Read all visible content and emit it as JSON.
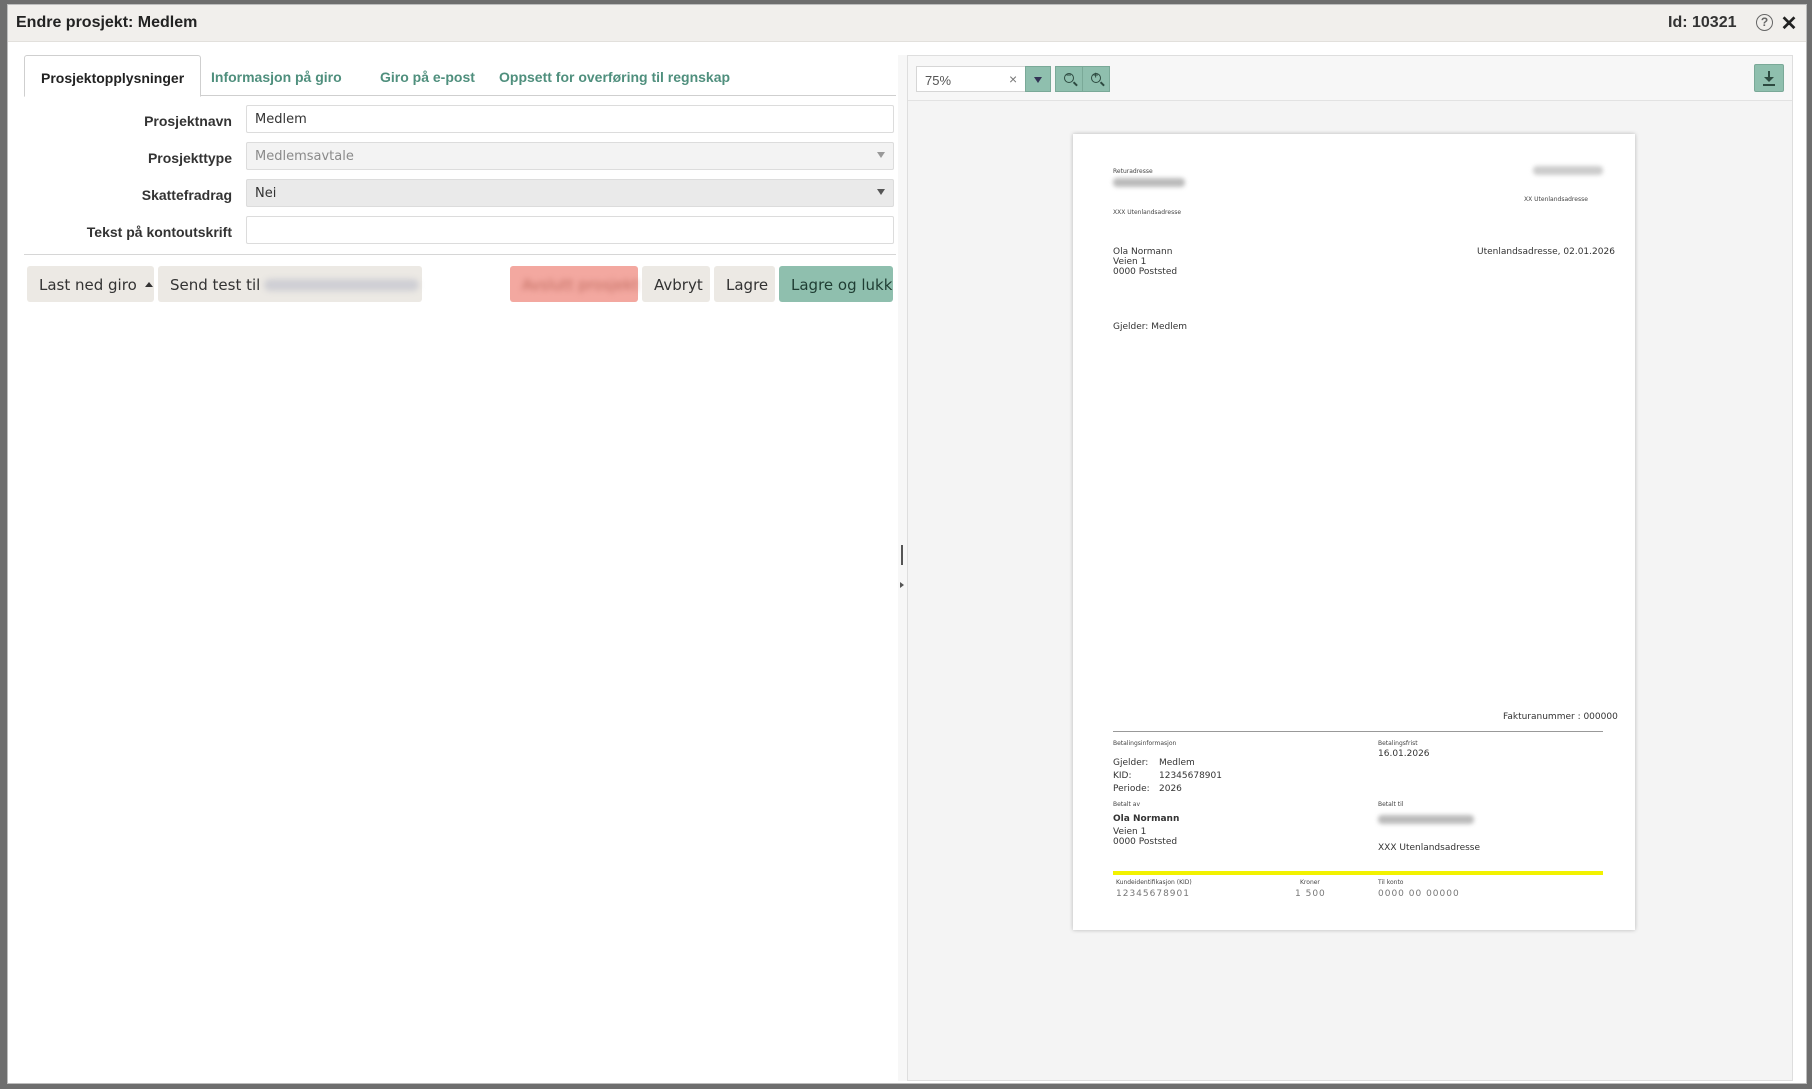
{
  "window": {
    "title": "Endre prosjekt: Medlem",
    "id_label": "Id: 10321",
    "help_icon": "help-icon",
    "close_icon": "close-icon"
  },
  "tabs": [
    {
      "label": "Prosjektopplysninger",
      "active": true
    },
    {
      "label": "Informasjon på giro",
      "active": false
    },
    {
      "label": "Giro på e-post",
      "active": false
    },
    {
      "label": "Oppsett for overføring til regnskap",
      "active": false
    }
  ],
  "form": {
    "name_label": "Prosjektnavn",
    "name_value": "Medlem",
    "type_label": "Prosjekttype",
    "type_value": "Medlemsavtale",
    "tax_label": "Skattefradrag",
    "tax_value": "Nei",
    "statement_label": "Tekst på kontoutskrift",
    "statement_value": ""
  },
  "actions": {
    "download_label": "Last ned giro",
    "send_test_label": "Send test til",
    "end_project_label": "Avslutt prosjekt",
    "cancel_label": "Avbryt",
    "save_label": "Lagre",
    "save_close_label": "Lagre og lukk"
  },
  "preview": {
    "zoom": "75%",
    "clear_symbol": "×",
    "zoom_out_sign": "−",
    "zoom_in_sign": "+",
    "page": {
      "return_label": "Returadresse",
      "sender_line": "XXX Utenlandsadresse",
      "right_header": "XX Utenlandsadresse",
      "recipient_name": "Ola Normann",
      "recipient_street": "Veien 1",
      "recipient_city": "0000 Poststed",
      "place_date": "Utenlandsadresse, 02.01.2026",
      "subject": "Gjelder: Medlem",
      "invoice_number": "Fakturanummer : 000000",
      "payment_info_label": "Betalingsinformasjon",
      "due_label": "Betalingsfrist",
      "due_date": "16.01.2026",
      "concerns_label": "Gjelder:",
      "concerns_value": "Medlem",
      "kid_label": "KID:",
      "kid_value": "12345678901",
      "period_label": "Periode:",
      "period_value": "2026",
      "paid_by_label": "Betalt av",
      "payer_name": "Ola Normann",
      "payer_street": "Veien 1",
      "payer_city": "0000 Poststed",
      "paid_to_label": "Betalt til",
      "payee_line": "XXX Utenlandsadresse",
      "kid_col_label": "Kundeidentifikasjon (KID)",
      "amount_col_label": "Kroner",
      "account_col_label": "Til konto",
      "kid_col_value": "12345678901",
      "amount_col_value": "1 500",
      "account_col_value": "0000 00 00000"
    }
  },
  "colors": {
    "accent": "#8fbfae",
    "tab_text": "#4f8f7d",
    "danger": "#f3a8a0",
    "kid_bar": "#f2f200"
  }
}
